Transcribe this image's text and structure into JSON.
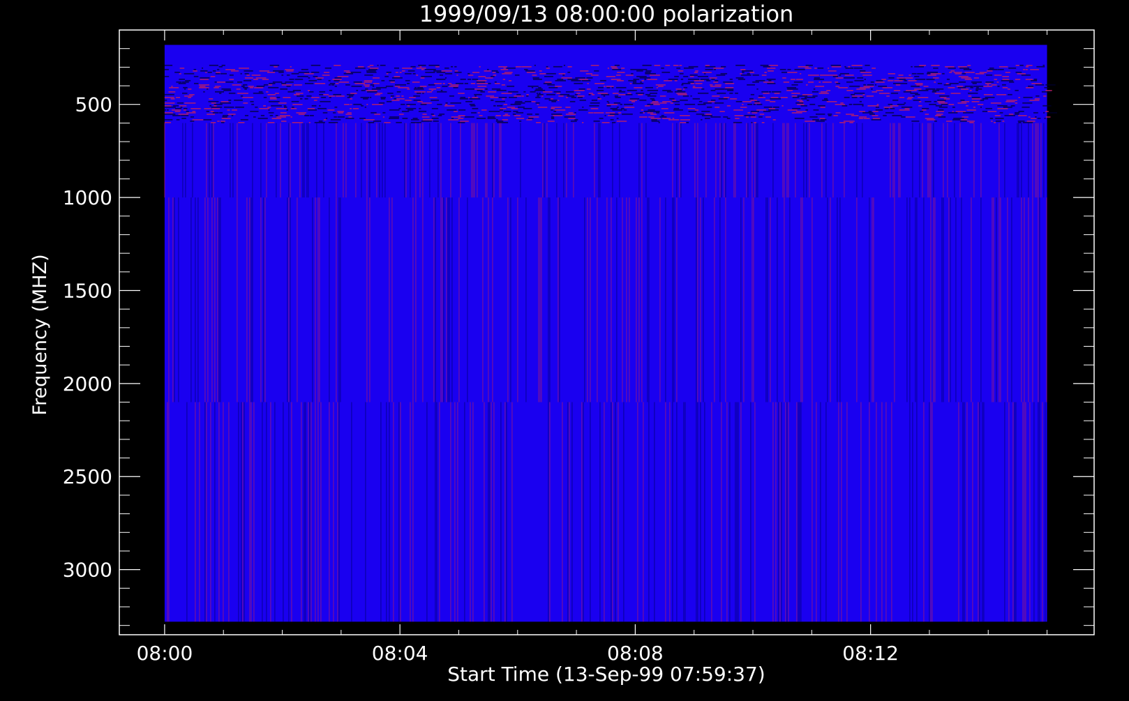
{
  "chart_data": {
    "type": "heatmap",
    "title": "1999/09/13 08:00:00 polarization",
    "xlabel": "Start Time (13-Sep-99 07:59:37)",
    "ylabel": "Frequency (MHZ)",
    "x_tick_labels": [
      "08:00",
      "08:04",
      "08:08",
      "08:12"
    ],
    "x_tick_values_min": [
      0,
      4,
      8,
      12
    ],
    "x_range_min": [
      -0.77,
      15.8
    ],
    "data_time_range_min": [
      0,
      15
    ],
    "y_ticks": [
      500,
      1000,
      1500,
      2000,
      2500,
      3000
    ],
    "y_range": [
      100,
      3350
    ],
    "y_inverted": true,
    "data_freq_range": [
      180,
      3280
    ],
    "bands_mhz": [
      {
        "from": 180,
        "to": 290,
        "texture": "flat"
      },
      {
        "from": 290,
        "to": 600,
        "texture": "noisy-horizontal"
      },
      {
        "from": 600,
        "to": 1000,
        "texture": "vertical-stripes"
      },
      {
        "from": 1000,
        "to": 2100,
        "texture": "vertical-stripes"
      },
      {
        "from": 2100,
        "to": 3280,
        "texture": "vertical-stripes"
      }
    ],
    "colors": {
      "background": "#000000",
      "axes": "#ffffff",
      "base": "#1a00f0",
      "high": "#c02060",
      "low": "#000070"
    }
  }
}
